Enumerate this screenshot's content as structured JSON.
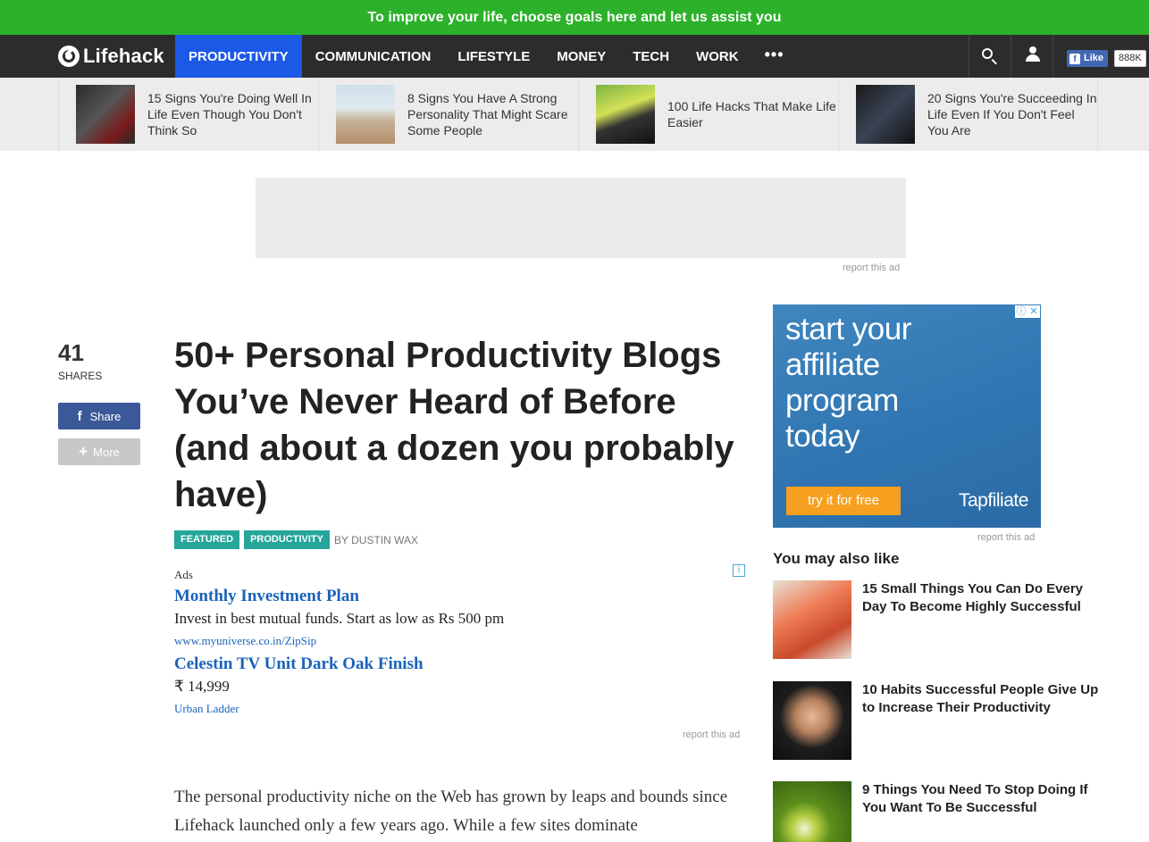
{
  "banner": {
    "text": "To improve your life, choose goals here and let us assist you"
  },
  "nav": {
    "logo_text": "Lifehack",
    "items": [
      {
        "label": "PRODUCTIVITY",
        "active": true
      },
      {
        "label": "COMMUNICATION",
        "active": false
      },
      {
        "label": "LIFESTYLE",
        "active": false
      },
      {
        "label": "MONEY",
        "active": false
      },
      {
        "label": "TECH",
        "active": false
      },
      {
        "label": "WORK",
        "active": false
      }
    ],
    "more_label": "•••",
    "fb_like_label": "Like",
    "fb_like_count": "888K"
  },
  "strip": {
    "items": [
      {
        "title": "15 Signs You're Doing Well In Life Even Though You Don't Think So"
      },
      {
        "title": "8 Signs You Have A Strong Personality That Might Scare Some People"
      },
      {
        "title": "100 Life Hacks That Make Life Easier"
      },
      {
        "title": "20 Signs You're Succeeding In Life Even If You Don't Feel You Are"
      }
    ]
  },
  "top_ad": {
    "report_label": "report this ad"
  },
  "share": {
    "count": "41",
    "count_label": "SHARES",
    "share_label": "Share",
    "more_label": "More"
  },
  "article": {
    "title": "50+ Personal Productivity Blogs You’ve Never Heard of Before (and about a dozen you probably have)",
    "tags": [
      "FEATURED",
      "PRODUCTIVITY"
    ],
    "byline": "BY DUSTIN WAX",
    "body": "The personal productivity niche on the Web has grown by leaps and bounds since Lifehack launched only a few years ago. While a few sites dominate"
  },
  "inline_ads": {
    "label": "Ads",
    "ads": [
      {
        "headline": "Monthly Investment Plan",
        "description": "Invest in best mutual funds. Start as low as Rs 500 pm",
        "url": "www.myuniverse.co.in/ZipSip"
      },
      {
        "headline": "Celestin TV Unit Dark Oak Finish",
        "description": "₹ 14,999",
        "url": "Urban Ladder"
      }
    ],
    "report_label": "report this ad"
  },
  "sidebar": {
    "ad": {
      "headline_lines": [
        "start your",
        "affiliate",
        "program",
        "today"
      ],
      "cta": "try it for free",
      "brand": "Tapfiliate",
      "report_label": "report this ad"
    },
    "heading": "You may also like",
    "related": [
      {
        "title": "15 Small Things You Can Do Every Day To Become Highly Successful"
      },
      {
        "title": "10 Habits Successful People Give Up to Increase Their Productivity"
      },
      {
        "title": "9 Things You Need To Stop Doing If You Want To Be Successful"
      }
    ]
  },
  "colors": {
    "banner_green": "#2cb12a",
    "nav_dark": "#2c2c2c",
    "nav_active_blue": "#1b59e6",
    "tag_teal": "#26a69a",
    "ad_link_blue": "#1a62b9",
    "facebook_blue": "#3b5998"
  },
  "icons": {
    "search": "search-icon",
    "user": "user-icon",
    "facebook": "facebook-icon",
    "plus": "plus-icon",
    "ad_info": "info-icon",
    "ad_close": "close-icon"
  }
}
